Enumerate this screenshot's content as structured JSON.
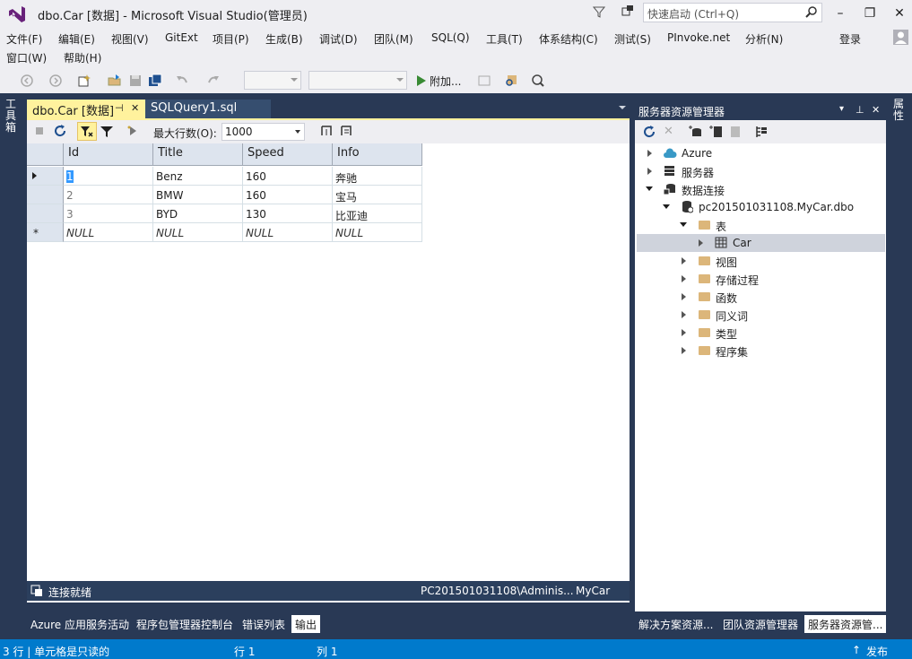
{
  "window": {
    "title": "dbo.Car [数据] - Microsoft Visual Studio(管理员)",
    "quick_launch_placeholder": "快速启动 (Ctrl+Q)"
  },
  "menu": {
    "items": [
      {
        "label": "文件(F)"
      },
      {
        "label": "编辑(E)"
      },
      {
        "label": "视图(V)"
      },
      {
        "label": "GitExt"
      },
      {
        "label": "项目(P)"
      },
      {
        "label": "生成(B)"
      },
      {
        "label": "调试(D)"
      },
      {
        "label": "团队(M)"
      },
      {
        "label": "SQL(Q)"
      },
      {
        "label": "工具(T)"
      },
      {
        "label": "体系结构(C)"
      },
      {
        "label": "测试(S)"
      },
      {
        "label": "PInvoke.net"
      },
      {
        "label": "分析(N)"
      }
    ],
    "row2": [
      {
        "label": "窗口(W)"
      },
      {
        "label": "帮助(H)"
      }
    ],
    "login": "登录"
  },
  "toolbar": {
    "attach_label": "附加..."
  },
  "left_strip_label": "工具箱",
  "right_strip_label": "属性",
  "tabs": {
    "active": "dbo.Car [数据]",
    "active_pin": "⊣",
    "active_close": "✕",
    "second": "SQLQuery1.sql"
  },
  "query_toolbar": {
    "max_rows_label": "最大行数(O):",
    "max_rows_value": "1000"
  },
  "grid": {
    "columns": [
      "Id",
      "Title",
      "Speed",
      "Info"
    ],
    "rows": [
      [
        "1",
        "Benz",
        "160",
        "奔驰"
      ],
      [
        "2",
        "BMW",
        "160",
        "宝马"
      ],
      [
        "3",
        "BYD",
        "130",
        "比亚迪"
      ],
      [
        "NULL",
        "NULL",
        "NULL",
        "NULL"
      ]
    ],
    "new_row_marker": "*"
  },
  "doc_status": {
    "connection": "连接就绪",
    "server": "PC201501031108\\Adminis...",
    "database": "MyCar"
  },
  "bottom_tabs": [
    {
      "label": "Azure 应用服务活动"
    },
    {
      "label": "程序包管理器控制台"
    },
    {
      "label": "错误列表"
    },
    {
      "label": "输出"
    }
  ],
  "server_explorer": {
    "title": "服务器资源管理器",
    "tree": {
      "azure": "Azure",
      "servers": "服务器",
      "data_connections": "数据连接",
      "connection": "pc201501031108.MyCar.dbo",
      "tables": "表",
      "car": "Car",
      "views": "视图",
      "procs": "存储过程",
      "functions": "函数",
      "synonyms": "同义词",
      "types": "类型",
      "assemblies": "程序集"
    },
    "bottom_tabs": [
      {
        "label": "解决方案资源..."
      },
      {
        "label": "团队资源管理器"
      },
      {
        "label": "服务器资源管..."
      }
    ]
  },
  "statusbar": {
    "left": "3 行 | 单元格是只读的",
    "line": "行 1",
    "col": "列 1",
    "publish": "发布"
  },
  "colors": {
    "accent": "#007acc",
    "frame": "#293955",
    "active_tab": "#fff29d",
    "vs_purple": "#68217a"
  }
}
